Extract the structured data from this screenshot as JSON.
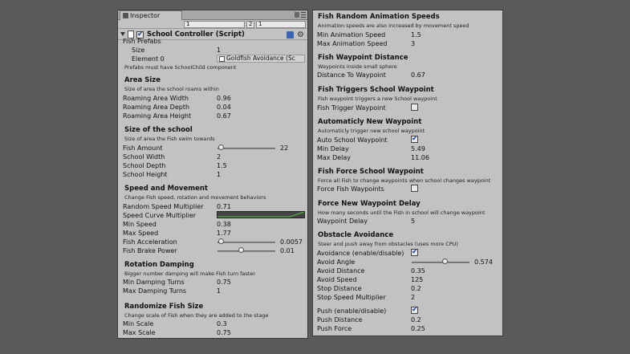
{
  "inspector": {
    "tab_label": "Inspector",
    "top_fields": [
      "1",
      "2",
      "1"
    ],
    "component": {
      "title": "School Controller (Script)",
      "enabled": true
    }
  },
  "left": {
    "fish_prefabs": {
      "label": "Fish Prefabs",
      "size_label": "Size",
      "size_value": "1",
      "element_label": "Element 0",
      "element_value": "Goldfish Avoidance (Sc",
      "note": "Prefabs must have SchoolChild component"
    },
    "area_size": {
      "title": "Area Size",
      "desc": "Size of area the school roams within",
      "rows": [
        {
          "label": "Roaming Area Width",
          "value": "0.96"
        },
        {
          "label": "Roaming Area Depth",
          "value": "0.04"
        },
        {
          "label": "Roaming Area Height",
          "value": "0.67"
        }
      ]
    },
    "school_size": {
      "title": "Size of the school",
      "desc": "Size of area the Fish swim towards",
      "fish_amount_label": "Fish Amount",
      "fish_amount_value": "22",
      "fish_amount_fraction": 0.05,
      "rows": [
        {
          "label": "School Width",
          "value": "2"
        },
        {
          "label": "School Depth",
          "value": "1.5"
        },
        {
          "label": "School Height",
          "value": "1"
        }
      ]
    },
    "speed": {
      "title": "Speed and Movement",
      "desc": "Change Fish speed, rotation and movement behaviors",
      "random_speed_label": "Random Speed Multiplier",
      "random_speed_value": "0.71",
      "curve_label": "Speed Curve Multiplier",
      "min_speed_label": "Min Speed",
      "min_speed_value": "0.38",
      "max_speed_label": "Max Speed",
      "max_speed_value": "1.77",
      "accel_label": "Fish Acceleration",
      "accel_value": "0.0057",
      "accel_fraction": 0.05,
      "brake_label": "Fish Brake Power",
      "brake_value": "0.01",
      "brake_fraction": 0.4
    },
    "rotation": {
      "title": "Rotation Damping",
      "desc": "Bigger number damping will make Fish turn faster",
      "rows": [
        {
          "label": "Min Damping Turns",
          "value": "0.75"
        },
        {
          "label": "Max Damping Turns",
          "value": "1"
        }
      ]
    },
    "scale": {
      "title": "Randomize Fish Size",
      "desc": "Change scale of Fish when they are added to the stage",
      "rows": [
        {
          "label": "Min Scale",
          "value": "0.3"
        },
        {
          "label": "Max Scale",
          "value": "0.75"
        }
      ]
    }
  },
  "right": {
    "anim": {
      "title": "Fish Random Animation Speeds",
      "desc": "Animation speeds are also increased by movement speed",
      "rows": [
        {
          "label": "Min Animation Speed",
          "value": "1.5"
        },
        {
          "label": "Max Animation Speed",
          "value": "3"
        }
      ]
    },
    "waypoint_distance": {
      "title": "Fish Waypoint Distance",
      "desc": "Waypoints inside small sphere",
      "label": "Distance To Waypoint",
      "value": "0.67"
    },
    "triggers": {
      "title": "Fish Triggers School Waypoint",
      "desc": "Fish waypoint triggers a new School waypoint",
      "label": "Fish Trigger Waypoint",
      "checked": false
    },
    "auto_waypoint": {
      "title": "Automaticly New Waypoint",
      "desc": "Automaticly trigger new school waypoint",
      "auto_label": "Auto School Waypoint",
      "auto_checked": true,
      "rows": [
        {
          "label": "Min Delay",
          "value": "5.49"
        },
        {
          "label": "Max Delay",
          "value": "11.06"
        }
      ]
    },
    "force_waypoint": {
      "title": "Fish Force School Waypoint",
      "desc": "Force all Fish to change waypoints when school changes waypoint",
      "label": "Force Fish Waypoints",
      "checked": false
    },
    "waypoint_delay": {
      "title": "Force New Waypoint Delay",
      "desc": "How many seconds until the Fish in school will change waypoint",
      "label": "Waypoint Delay",
      "value": "5"
    },
    "obstacle": {
      "title": "Obstacle Avoidance",
      "desc": "Steer and push away from obstacles (uses more CPU)",
      "avoid_label": "Avoidance (enable/disable)",
      "avoid_checked": true,
      "angle_label": "Avoid Angle",
      "angle_value": "0.574",
      "angle_fraction": 0.574,
      "rows": [
        {
          "label": "Avoid Distance",
          "value": "0.35"
        },
        {
          "label": "Avoid Speed",
          "value": "125"
        },
        {
          "label": "Stop Distance",
          "value": "0.2"
        },
        {
          "label": "Stop Speed Multiplier",
          "value": "2"
        }
      ],
      "push_label": "Push (enable/disable)",
      "push_checked": true,
      "push_rows": [
        {
          "label": "Push Distance",
          "value": "0.2"
        },
        {
          "label": "Push Force",
          "value": "0.25"
        }
      ]
    }
  },
  "colors": {
    "panel_bg": "#c2c2c2",
    "window_bg": "#5a5a5a",
    "checkbox_accent": "#1d3f8f",
    "curve_line": "#5fbf3f"
  }
}
